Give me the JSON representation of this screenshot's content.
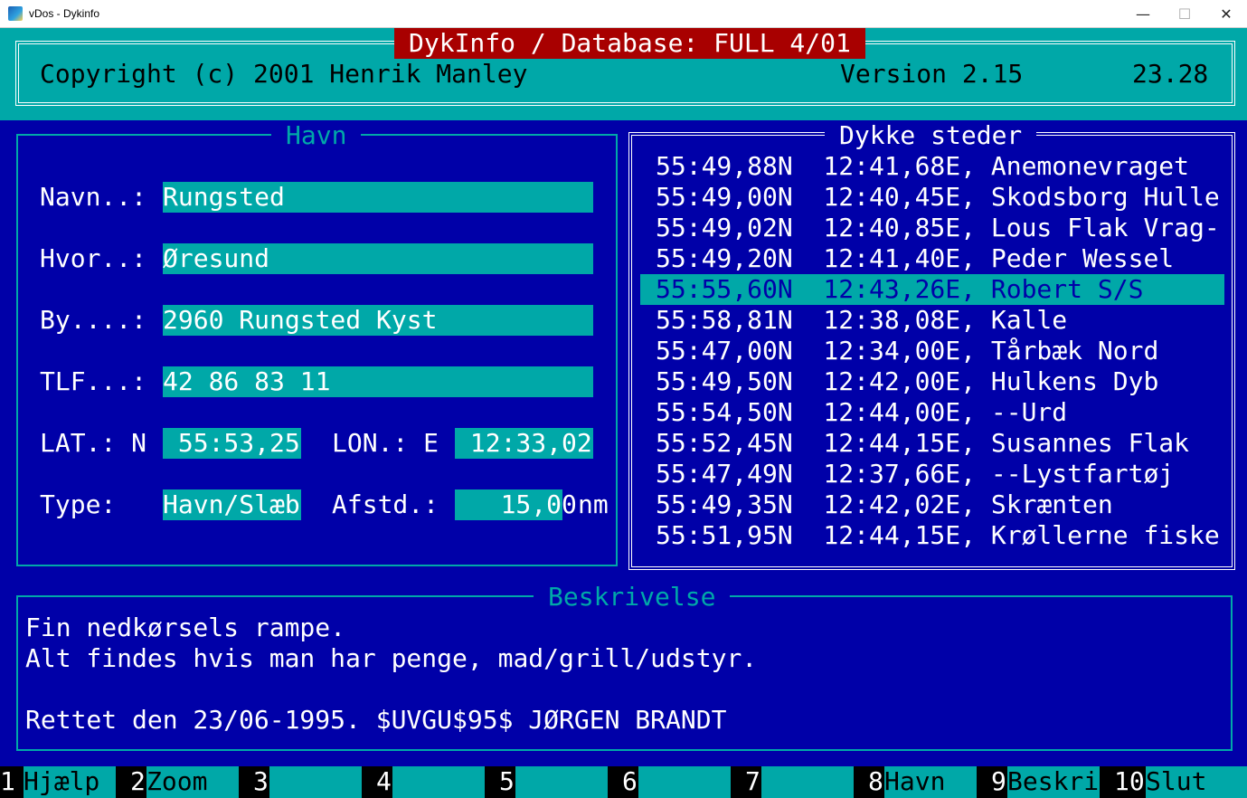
{
  "window": {
    "title": "vDos - Dykinfo",
    "minimize": "—",
    "maximize": "☐",
    "close": "✕"
  },
  "header": {
    "title": "DykInfo / Database: FULL 4/01",
    "copyright": "Copyright (c) 2001 Henrik Manley",
    "version": "Version 2.15",
    "clock": "23.28"
  },
  "havn": {
    "title": "Havn",
    "navn_label": "Navn..:",
    "navn_value": "Rungsted",
    "hvor_label": "Hvor..:",
    "hvor_value": "Øresund",
    "by_label": "By....:",
    "by_value": "2960 Rungsted Kyst",
    "tlf_label": "TLF...:",
    "tlf_value": "42 86 83 11",
    "lat_label": "LAT.: N",
    "lat_value": " 55:53,25",
    "lon_label": "LON.: E",
    "lon_value": " 12:33,02",
    "type_label": "Type:",
    "type_value": "Havn/Slæb",
    "afstd_label": "Afstd.:",
    "afstd_value": "   15,00",
    "afstd_unit": "nm"
  },
  "sites": {
    "title": "Dykke steder",
    "selected_index": 4,
    "items": [
      "55:49,88N  12:41,68E, Anemonevraget",
      "55:49,00N  12:40,45E, Skodsborg Hulle",
      "55:49,02N  12:40,85E, Lous Flak Vrag-",
      "55:49,20N  12:41,40E, Peder Wessel",
      "55:55,60N  12:43,26E, Robert S/S",
      "55:58,81N  12:38,08E, Kalle",
      "55:47,00N  12:34,00E, Tårbæk Nord",
      "55:49,50N  12:42,00E, Hulkens Dyb",
      "55:54,50N  12:44,00E, --Urd",
      "55:52,45N  12:44,15E, Susannes Flak",
      "55:47,49N  12:37,66E, --Lystfartøj",
      "55:49,35N  12:42,02E, Skrænten",
      "55:51,95N  12:44,15E, Krøllerne fiske"
    ]
  },
  "description": {
    "title": "Beskrivelse",
    "lines": [
      "Fin nedkørsels rampe.",
      "Alt findes hvis man har penge, mad/grill/udstyr.",
      "",
      "Rettet den 23/06-1995. $UVGU$95$ JØRGEN BRANDT"
    ]
  },
  "function_keys": [
    {
      "num": "1",
      "label": "Hjælp"
    },
    {
      "num": "2",
      "label": "Zoom"
    },
    {
      "num": "3",
      "label": ""
    },
    {
      "num": "4",
      "label": ""
    },
    {
      "num": "5",
      "label": ""
    },
    {
      "num": "6",
      "label": ""
    },
    {
      "num": "7",
      "label": ""
    },
    {
      "num": "8",
      "label": "Havn"
    },
    {
      "num": "9",
      "label": "Beskri"
    },
    {
      "num": "10",
      "label": "Slut"
    }
  ]
}
